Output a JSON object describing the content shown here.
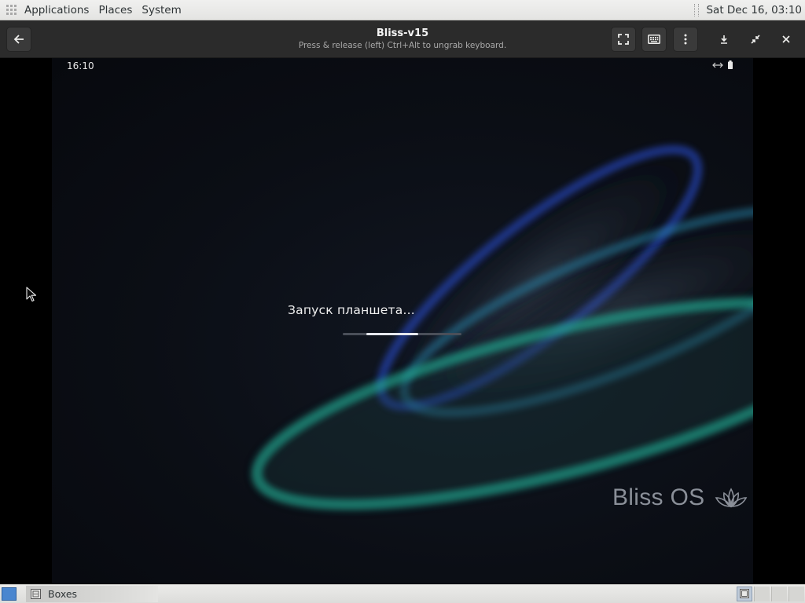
{
  "top_panel": {
    "menus": [
      "Applications",
      "Places",
      "System"
    ],
    "clock": "Sat Dec 16, 03:10"
  },
  "headerbar": {
    "title": "Bliss-v15",
    "subtitle": "Press & release (left) Ctrl+Alt to ungrab keyboard.",
    "icons": {
      "back": "arrow-left-icon",
      "fullscreen": "fullscreen-icon",
      "keyboard": "keyboard-icon",
      "menu": "vertical-ellipsis-icon",
      "minimize": "minimize-icon",
      "restore": "restore-icon",
      "close": "close-icon"
    }
  },
  "guest": {
    "status_time": "16:10",
    "boot_text": "Запуск планшета...",
    "progress": {
      "start_fraction": 0.2,
      "end_fraction": 0.64
    },
    "brand": "Bliss OS",
    "colors": {
      "blue_wave": "#2a4fd8",
      "teal_wave": "#22b39a",
      "background": "#0b0e15"
    }
  },
  "bottom_panel": {
    "task": "Boxes",
    "workspaces": 4,
    "active_workspace": 1
  }
}
